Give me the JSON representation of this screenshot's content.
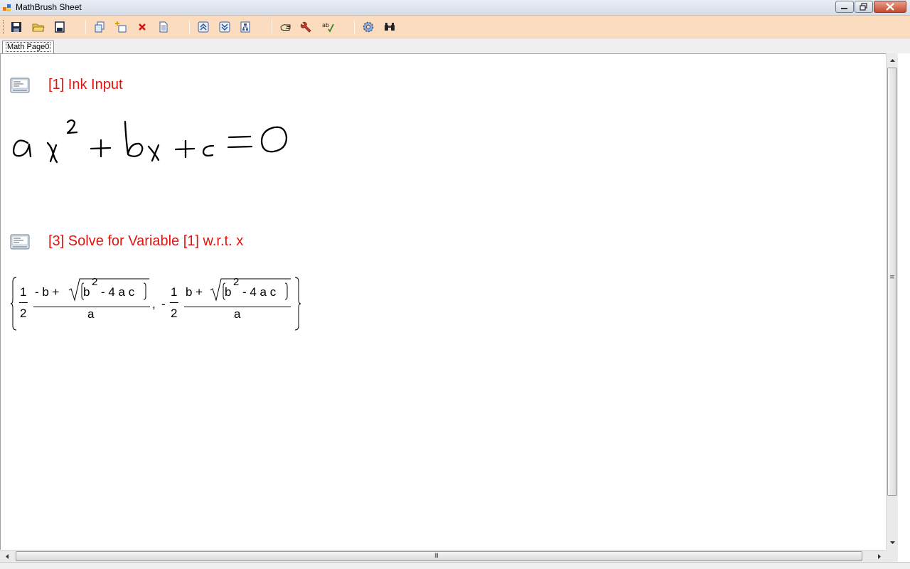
{
  "window": {
    "title": "MathBrush Sheet"
  },
  "toolbar": {
    "buttons": [
      {
        "name": "save-icon"
      },
      {
        "name": "open-folder-icon"
      },
      {
        "name": "save-as-icon"
      },
      {
        "name": "copy-icon"
      },
      {
        "name": "insert-icon"
      },
      {
        "name": "delete-icon"
      },
      {
        "name": "page-icon"
      },
      {
        "name": "move-up-icon"
      },
      {
        "name": "move-down-icon"
      },
      {
        "name": "hierarchy-icon"
      },
      {
        "name": "hand-icon"
      },
      {
        "name": "wrench-icon"
      },
      {
        "name": "spellcheck-icon"
      },
      {
        "name": "gear-icon"
      },
      {
        "name": "binoculars-icon"
      }
    ],
    "spellcheck_label": "ab"
  },
  "tabs": [
    {
      "label": "Math Page0",
      "active": true
    }
  ],
  "cells": [
    {
      "title": "[1] Ink Input",
      "type": "ink",
      "ink_glyphs": {
        "a": "a",
        "x1": "x",
        "two": "2",
        "plus1": "+",
        "b": "b",
        "x2": "x",
        "plus2": "+",
        "c": "c",
        "eq": "=",
        "zero": "0"
      }
    },
    {
      "title": "[3] Solve for Variable [1] w.r.t. x",
      "type": "result",
      "math": {
        "one_a": "1",
        "two_a": "2",
        "num_a_prefix": "- b +",
        "b_a": "b",
        "exp_a": "2",
        "rad_a_rest": "- 4 a c",
        "den_a": "a",
        "comma": ",",
        "minus": "-",
        "one_b": "1",
        "two_b": "2",
        "num_b_prefix": "b +",
        "b_b": "b",
        "exp_b": "2",
        "rad_b_rest": "- 4 a c",
        "den_b": "a"
      }
    }
  ],
  "scrollbars": {
    "vertical_grip": "≡",
    "horizontal_grip": "III"
  }
}
